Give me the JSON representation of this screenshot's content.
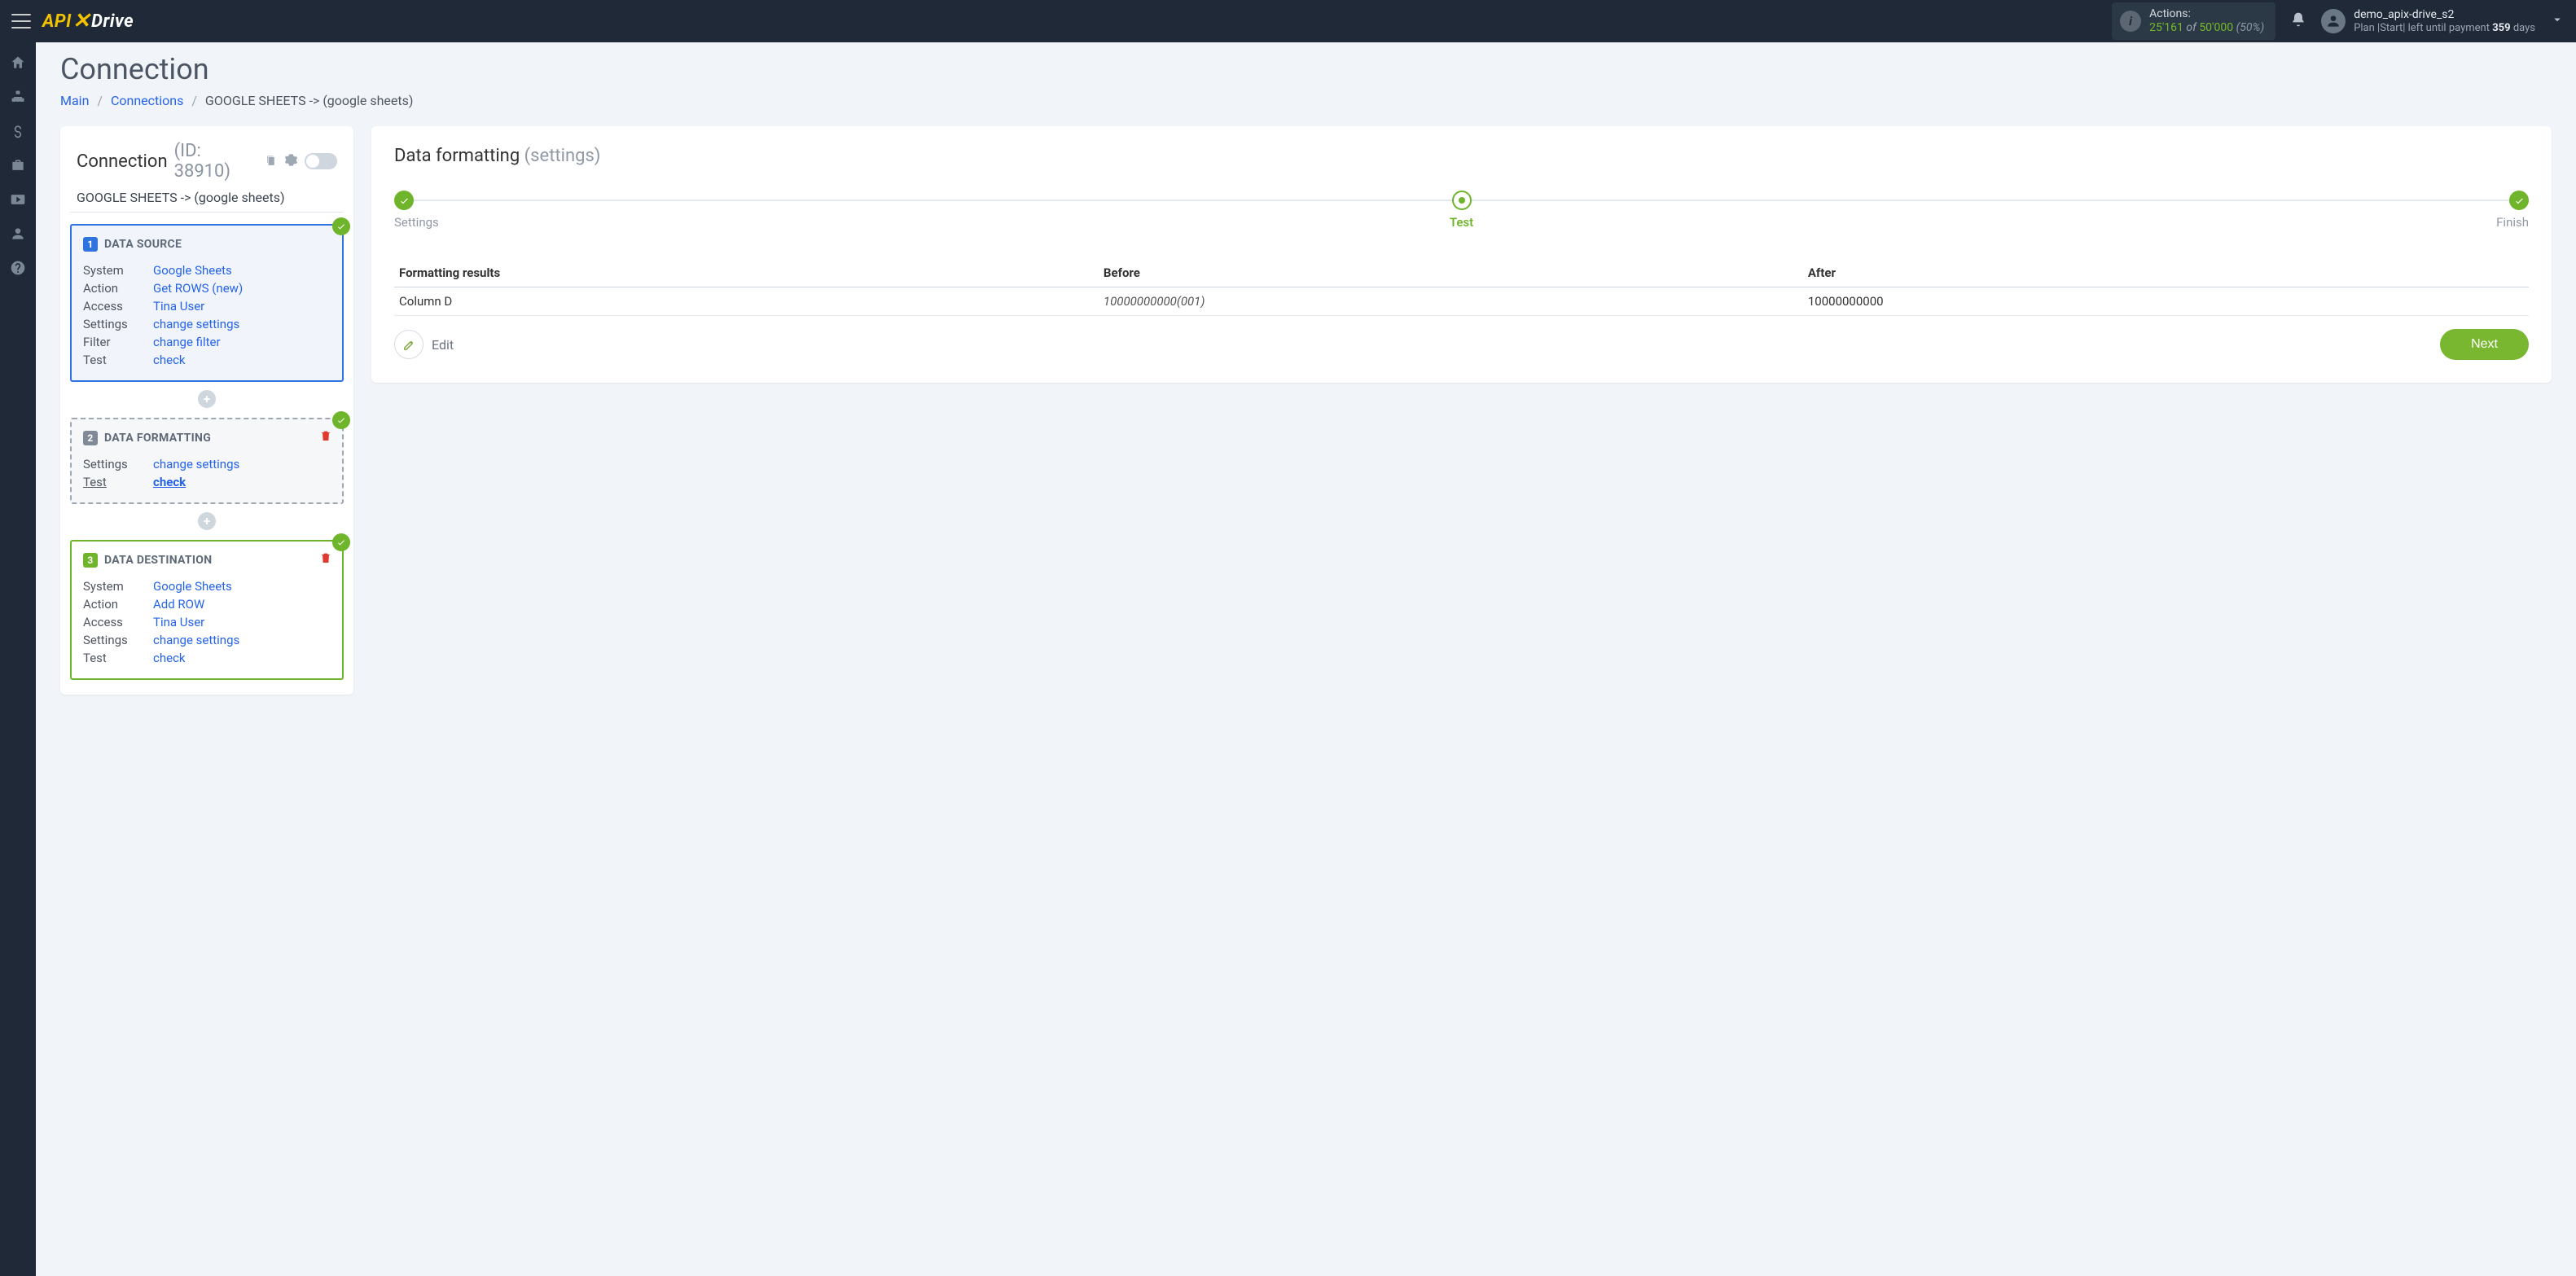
{
  "topbar": {
    "logo_api": "API",
    "logo_drive": "Drive",
    "actions_label": "Actions:",
    "actions_used": "25'161",
    "actions_of": "of",
    "actions_total": "50'000",
    "actions_pct": "(50%)",
    "user_name": "demo_apix-drive_s2",
    "plan_prefix": "Plan |Start| left until payment ",
    "plan_days_n": "359",
    "plan_days_suffix": " days"
  },
  "breadcrumbs": {
    "main": "Main",
    "connections": "Connections",
    "current": "GOOGLE SHEETS -> (google sheets)"
  },
  "page": {
    "title": "Connection"
  },
  "conn_panel": {
    "heading": "Connection",
    "id_label": "(ID: 38910)",
    "subtitle": "GOOGLE SHEETS -> (google sheets)"
  },
  "steps": {
    "source": {
      "num": "1",
      "title": "DATA SOURCE",
      "labels": {
        "system": "System",
        "action": "Action",
        "access": "Access",
        "settings": "Settings",
        "filter": "Filter",
        "test": "Test"
      },
      "values": {
        "system": "Google Sheets",
        "action": "Get ROWS (new)",
        "access": "Tina User",
        "settings": "change settings",
        "filter": "change filter",
        "test": "check"
      }
    },
    "format": {
      "num": "2",
      "title": "DATA FORMATTING",
      "labels": {
        "settings": "Settings",
        "test": "Test"
      },
      "values": {
        "settings": "change settings",
        "test": "check"
      }
    },
    "dest": {
      "num": "3",
      "title": "DATA DESTINATION",
      "labels": {
        "system": "System",
        "action": "Action",
        "access": "Access",
        "settings": "Settings",
        "test": "Test"
      },
      "values": {
        "system": "Google Sheets",
        "action": "Add ROW",
        "access": "Tina User",
        "settings": "change settings",
        "test": "check"
      }
    }
  },
  "right": {
    "title": "Data formatting",
    "title_sub": "(settings)",
    "stepper": {
      "settings": "Settings",
      "test": "Test",
      "finish": "Finish"
    },
    "table": {
      "head": {
        "col1": "Formatting results",
        "col2": "Before",
        "col3": "After"
      },
      "row1": {
        "col1": "Column D",
        "col2": "10000000000(001)",
        "col3": "10000000000"
      }
    },
    "edit_label": "Edit",
    "next_label": "Next"
  }
}
